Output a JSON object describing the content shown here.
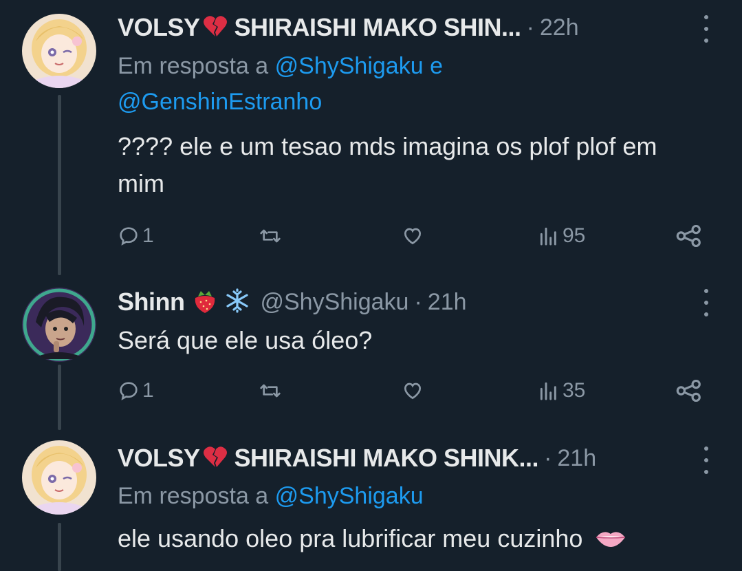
{
  "tweets": [
    {
      "name": "VOLSY",
      "name_rest": "SHIRAISHI MAKO SHIN...",
      "time": "22h",
      "reply_prefix": "Em resposta a ",
      "reply_mentions": [
        "@ShyShigaku",
        " e ",
        "@GenshinEstranho"
      ],
      "text": "???? ele e um tesao mds imagina os plof plof em mim",
      "replies": "1",
      "views": "95"
    },
    {
      "name": "Shinn",
      "handle": "@ShyShigaku",
      "time": "21h",
      "text": "Será que ele usa óleo?",
      "replies": "1",
      "views": "35"
    },
    {
      "name": "VOLSY",
      "name_rest": "SHIRAISHI MAKO SHINK...",
      "time": "21h",
      "reply_prefix": "Em resposta a ",
      "reply_mentions": [
        "@ShyShigaku"
      ],
      "text": "ele usando oleo pra lubrificar meu cuzinho"
    }
  ],
  "colors": {
    "background": "#15202b",
    "text": "#e7e9ea",
    "muted": "#8b98a5",
    "link": "#1d9bf0",
    "thread_line": "#38444d"
  },
  "icons": [
    "broken-heart-emoji",
    "strawberry-emoji",
    "snowflake-emoji",
    "lips-emoji",
    "reply-icon",
    "retweet-icon",
    "like-icon",
    "views-icon",
    "share-icon",
    "more-icon"
  ]
}
